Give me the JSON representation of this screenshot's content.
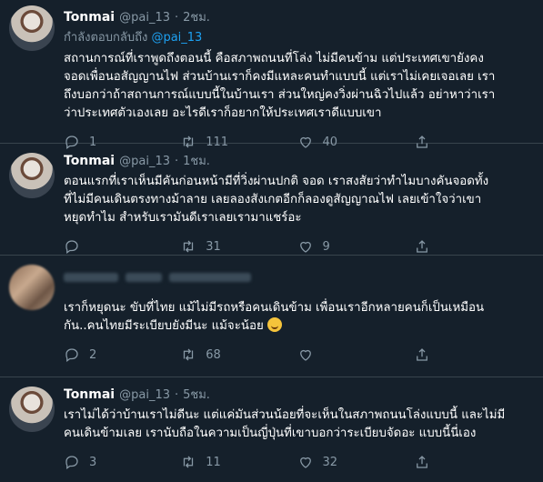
{
  "tweets": [
    {
      "name": "Tonmai",
      "handle": "@pai_13",
      "dot": "·",
      "time": "2ชม.",
      "reply_prefix": "กำลังตอบกลับถึง",
      "reply_handle": "@pai_13",
      "text": "สถานการณ์ที่เราพูดถึงตอนนี้ คือสภาพถนนที่โล่ง ไม่มีคนข้าม แต่ประเทศเขายังคง\nจอดเพื่อนอสัญญานไฟ ส่วนบ้านเราก็คงมีแหละคนทำแบบนี้ แต่เราไม่เคยเจอเลย เรา\nถึงบอกว่าถ้าสถานการณ์แบบนี้ในบ้านเรา ส่วนใหญ่คงวิ่งผ่านฉิวไปแล้ว อย่าหาว่าเรา\nว่าประเทศตัวเองเลย อะไรดีเราก็อยากให้ประเทศเราดีแบบเขา",
      "replies": "1",
      "retweets": "111",
      "likes": "40"
    },
    {
      "name": "Tonmai",
      "handle": "@pai_13",
      "dot": "·",
      "time": "1ชม.",
      "text": "ตอนแรกที่เราเห็นมีคันก่อนหน้ามีที่วิ่งผ่านปกติ จอด เราสงสัยว่าทำไมบางคันจอดทั้ง\nที่ไม่มีคนเดินตรงทางม้าลาย เลยลองสังเกตอีกก็ลองดูสัญญาณไฟ เลยเข้าใจว่าเขา\nหยุดทำไม สำหรับเรามันดีเราเลยเรามาแชร์อะ",
      "replies": "",
      "retweets": "31",
      "likes": "9"
    },
    {
      "text": "เราก็หยุดนะ ขับที่ไทย แม้ไม่มีรถหรือคนเดินข้าม เพื่อนเราอีกหลายคนก็เป็นเหมือน\nกัน..คนไทยมีระเบียบยังมีนะ แม้จะน้อย",
      "replies": "2",
      "retweets": "68",
      "likes": "",
      "emoji": "smiling-sweat-emoji"
    },
    {
      "name": "Tonmai",
      "handle": "@pai_13",
      "dot": "·",
      "time": "5ชม.",
      "text": "เราไม่ได้ว่าบ้านเราไม่ดีนะ แต่แค่มันส่วนน้อยที่จะเห็นในสภาพถนนโล่งแบบนี้ และไม่มี\nคนเดินข้ามเลย เรานับถือในความเป็นญี่ปุ่นที่เขาบอกว่าระเบียบจัดอะ แบบนี้นี่เอง",
      "replies": "3",
      "retweets": "11",
      "likes": "32"
    }
  ],
  "colors": {
    "background": "#15202b",
    "secondary": "#8899a6",
    "accent": "#1da1f2",
    "border": "#38444d"
  }
}
